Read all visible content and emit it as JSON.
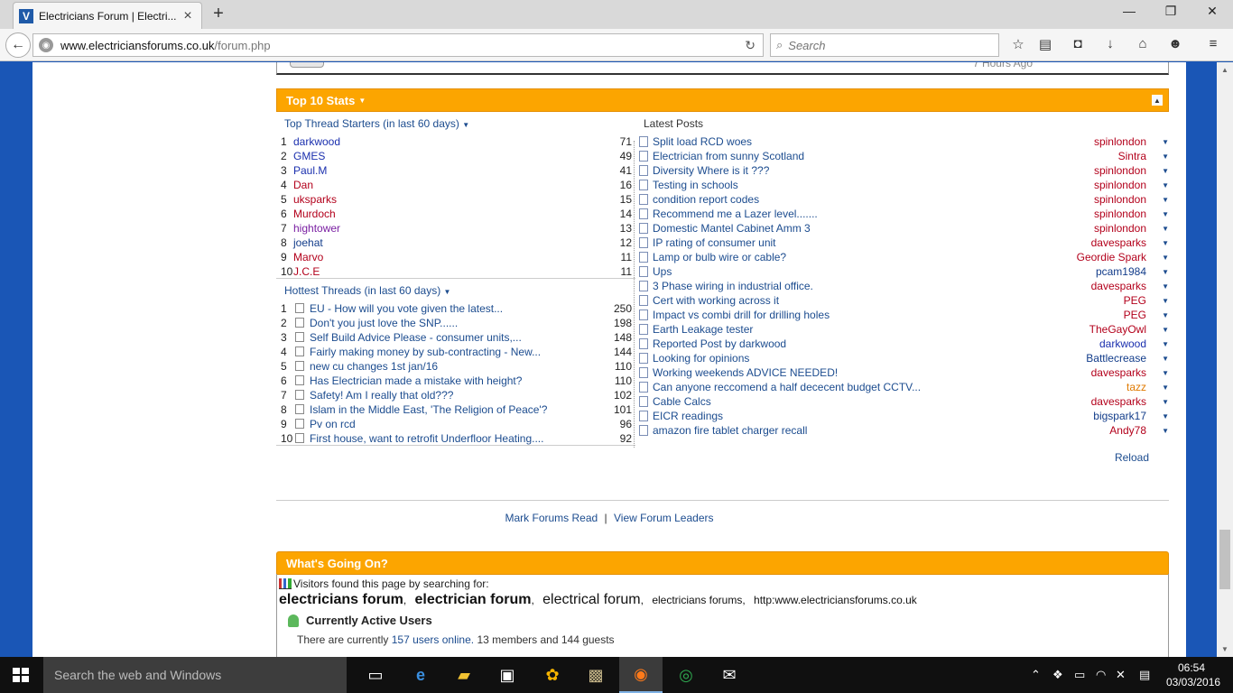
{
  "browser": {
    "tab_title": "Electricians Forum | Electri...",
    "url_domain": "www.electriciansforums.co.uk",
    "url_path": "/forum.php",
    "search_placeholder": "Search"
  },
  "page": {
    "prev_block_time": "7 Hours Ago",
    "top10": {
      "title": "Top 10 Stats",
      "starters_title": "Top Thread Starters (in last 60 days)",
      "starters": [
        {
          "rank": "1",
          "name": "darkwood",
          "count": "71",
          "color": "blue"
        },
        {
          "rank": "2",
          "name": "GMES",
          "count": "49",
          "color": "blue"
        },
        {
          "rank": "3",
          "name": "Paul.M",
          "count": "41",
          "color": "blue"
        },
        {
          "rank": "4",
          "name": "Dan",
          "count": "16",
          "color": "red"
        },
        {
          "rank": "5",
          "name": "uksparks",
          "count": "15",
          "color": "red"
        },
        {
          "rank": "6",
          "name": "Murdoch",
          "count": "14",
          "color": "red"
        },
        {
          "rank": "7",
          "name": "hightower",
          "count": "13",
          "color": "purple"
        },
        {
          "rank": "8",
          "name": "joehat",
          "count": "12",
          "color": "navy"
        },
        {
          "rank": "9",
          "name": "Marvo",
          "count": "11",
          "color": "red"
        },
        {
          "rank": "10",
          "name": "J.C.E",
          "count": "11",
          "color": "red"
        }
      ],
      "hottest_title": "Hottest Threads (in last 60 days)",
      "hottest": [
        {
          "rank": "1",
          "title": "EU - How will you vote given the latest...",
          "count": "250"
        },
        {
          "rank": "2",
          "title": "Don't you just love the SNP......",
          "count": "198"
        },
        {
          "rank": "3",
          "title": "Self Build Advice Please - consumer units,...",
          "count": "148"
        },
        {
          "rank": "4",
          "title": "Fairly making money by sub-contracting - New...",
          "count": "144"
        },
        {
          "rank": "5",
          "title": "new cu changes 1st jan/16",
          "count": "110"
        },
        {
          "rank": "6",
          "title": "Has Electrician made a mistake with height?",
          "count": "110"
        },
        {
          "rank": "7",
          "title": "Safety! Am I really that old???",
          "count": "102"
        },
        {
          "rank": "8",
          "title": "Islam in the Middle East, 'The Religion of Peace'?",
          "count": "101"
        },
        {
          "rank": "9",
          "title": "Pv on rcd",
          "count": "96"
        },
        {
          "rank": "10",
          "title": "First house, want to retrofit Underfloor Heating....",
          "count": "92"
        }
      ],
      "latest_title": "Latest Posts",
      "latest": [
        {
          "title": "Split load RCD woes",
          "user": "spinlondon",
          "color": "red"
        },
        {
          "title": "Electrician from sunny Scotland",
          "user": "Sintra",
          "color": "red"
        },
        {
          "title": "Diversity Where is it ???",
          "user": "spinlondon",
          "color": "red"
        },
        {
          "title": "Testing in schools",
          "user": "spinlondon",
          "color": "red"
        },
        {
          "title": "condition report codes",
          "user": "spinlondon",
          "color": "red"
        },
        {
          "title": "Recommend me a Lazer level.......",
          "user": "spinlondon",
          "color": "red"
        },
        {
          "title": "Domestic Mantel Cabinet Amm 3",
          "user": "spinlondon",
          "color": "red"
        },
        {
          "title": "IP rating of consumer unit",
          "user": "davesparks",
          "color": "red"
        },
        {
          "title": "Lamp or bulb wire or cable?",
          "user": "Geordie Spark",
          "color": "red"
        },
        {
          "title": "Ups",
          "user": "pcam1984",
          "color": "navy"
        },
        {
          "title": "3 Phase wiring in industrial office.",
          "user": "davesparks",
          "color": "red"
        },
        {
          "title": "Cert with working across it",
          "user": "PEG",
          "color": "red"
        },
        {
          "title": "Impact vs combi drill for drilling holes",
          "user": "PEG",
          "color": "red"
        },
        {
          "title": "Earth Leakage tester",
          "user": "TheGayOwl",
          "color": "red"
        },
        {
          "title": "Reported Post by darkwood",
          "user": "darkwood",
          "color": "blue"
        },
        {
          "title": "Looking for opinions",
          "user": "Battlecrease",
          "color": "navy"
        },
        {
          "title": "Working weekends ADVICE NEEDED!",
          "user": "davesparks",
          "color": "red"
        },
        {
          "title": "Can anyone reccomend a half dececent budget CCTV...",
          "user": "tazz",
          "color": "orange"
        },
        {
          "title": "Cable Calcs",
          "user": "davesparks",
          "color": "red"
        },
        {
          "title": "EICR readings",
          "user": "bigspark17",
          "color": "navy"
        },
        {
          "title": "amazon fire tablet charger recall",
          "user": "Andy78",
          "color": "red"
        }
      ],
      "reload": "Reload"
    },
    "footer": {
      "mark_read": "Mark Forums Read",
      "separator": "|",
      "leaders": "View Forum Leaders"
    },
    "wgo": {
      "title": "What's Going On?",
      "visitors_label": "Visitors found this page by searching for:",
      "kw1": "electricians forum",
      "kw2": "electrician forum",
      "kw3": "electrical forum",
      "kw4": "electricians forums",
      "kw5": "http:www.electriciansforums.co.uk",
      "comma": ",",
      "active_title": "Currently Active Users",
      "active_prefix": "There are currently",
      "active_link": "157 users online.",
      "active_suffix": "13 members and 144 guests"
    }
  },
  "taskbar": {
    "search_text": "Search the web and Windows",
    "time": "06:54",
    "date": "03/03/2016"
  }
}
